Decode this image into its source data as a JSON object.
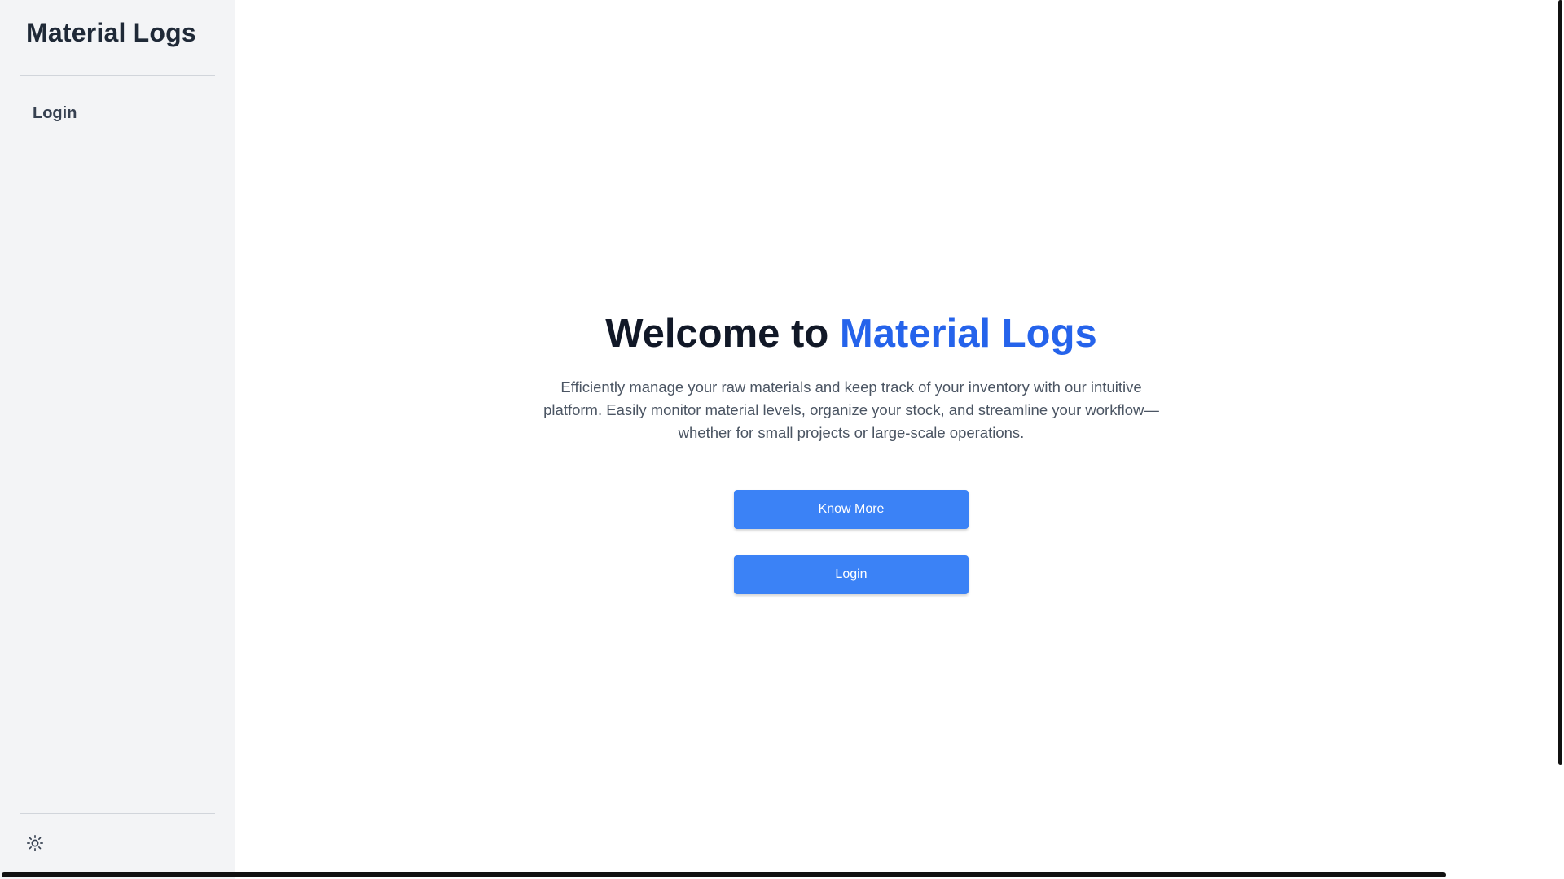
{
  "sidebar": {
    "brand": "Material Logs",
    "nav_items": [
      {
        "label": "Login"
      }
    ],
    "theme_toggle_icon": "sun-icon"
  },
  "hero": {
    "title_prefix": "Welcome to ",
    "title_accent": "Material Logs",
    "description": "Efficiently manage your raw materials and keep track of your inventory with our intuitive platform. Easily monitor material levels, organize your stock, and streamline your workflow—whether for small projects or large-scale operations.",
    "know_more_label": "Know More",
    "login_label": "Login"
  },
  "colors": {
    "accent": "#2563eb",
    "button": "#3b82f6",
    "sidebar_bg": "#f3f4f6",
    "title": "#111827"
  }
}
